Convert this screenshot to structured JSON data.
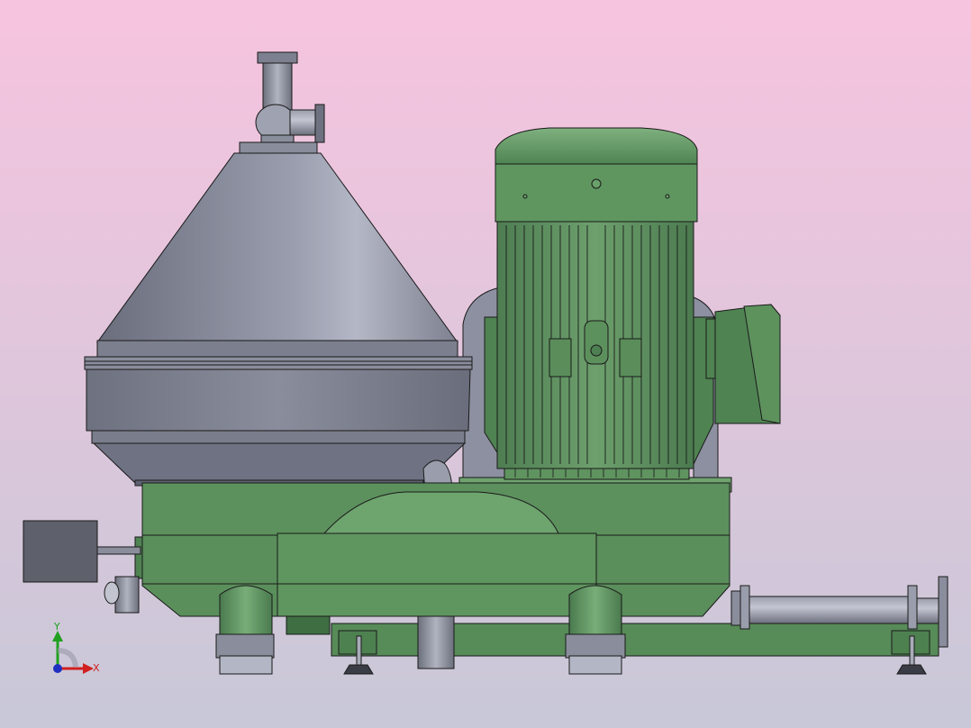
{
  "viewport": {
    "background_top": "#f7c4df",
    "background_bottom": "#c8c8d8"
  },
  "colors": {
    "body_green": "#5b8f5b",
    "body_green_light": "#72a872",
    "body_green_dark": "#3f6e43",
    "steel": "#8a8e9e",
    "steel_light": "#b2b5c4",
    "steel_dark": "#5c5f6c",
    "outline": "#1a1a1a"
  },
  "triad": {
    "x_label": "X",
    "y_label": "Y",
    "x_color": "#d02020",
    "y_color": "#20a020",
    "z_color": "#2030c0"
  }
}
